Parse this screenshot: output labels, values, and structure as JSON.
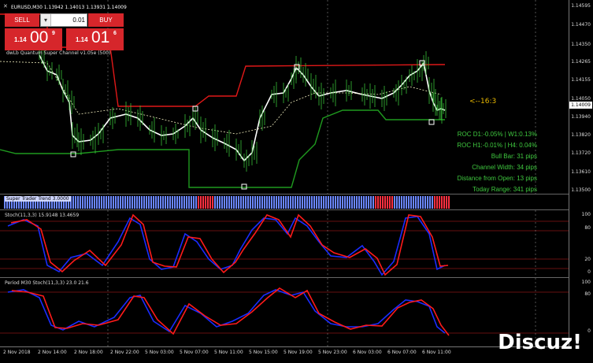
{
  "chart_header": "EURUSD,M30  1.13942 1.14013 1.13931 1.14009",
  "indicator_title": "dwLb Quantum Super Channel v1.05e (500)",
  "trade_panel": {
    "sell_label": "SELL",
    "buy_label": "BUY",
    "lot": "0.01",
    "sell_small": "1.14",
    "sell_big": "00",
    "sell_sup": "9",
    "buy_small": "1.14",
    "buy_big": "01",
    "buy_sup": "6"
  },
  "arrow_label": "<--16:3",
  "info_lines": [
    "ROC  D1:-0.05% | W1:0.13%",
    "ROC  H1:-0.01% | H4: 0.04%",
    "Bull Bar: 31 pips",
    "Channel Width: 34 pips",
    "Distance from Open:  13 pips",
    "Today Range:  341 pips"
  ],
  "price_axis": [
    "1.14595",
    "1.14470",
    "1.14350",
    "1.14265",
    "1.14155",
    "1.14050",
    "1.13940",
    "1.13820",
    "1.13720",
    "1.13610",
    "1.13500"
  ],
  "current_price": "1.14009",
  "trend_label": "Super Trader Trend 3.0000",
  "stoch1_label": "Stoch(11,3,3) 15.9148 13.4659",
  "stoch1_axis": [
    "100",
    "80",
    "20",
    "0"
  ],
  "stoch2_label": "Period M30 Stoch(11,3,3) 23.0 21.6",
  "stoch2_axis": [
    "100",
    "80",
    "0"
  ],
  "time_labels": [
    "2 Nov 2018",
    "2 Nov 14:00",
    "2 Nov 18:00",
    "2 Nov 22:00",
    "5 Nov 03:00",
    "5 Nov 07:00",
    "5 Nov 11:00",
    "5 Nov 15:00",
    "5 Nov 19:00",
    "5 Nov 23:00",
    "6 Nov 03:00",
    "6 Nov 07:00",
    "6 Nov 11:00"
  ],
  "watermark": "Discuz!",
  "colors": {
    "upper_channel": "#e01818",
    "lower_channel": "#1f9a1f",
    "price": "#ffffff",
    "candles": "#37c037",
    "stoch_main": "#1a2cff",
    "stoch_signal": "#ff1a1a",
    "trend_bull": "#6b87ff",
    "trend_bear": "#ff3040",
    "info_text": "#3fc93f",
    "arrow_text": "#e8b800"
  },
  "icons": {
    "window_close": "close-icon"
  }
}
